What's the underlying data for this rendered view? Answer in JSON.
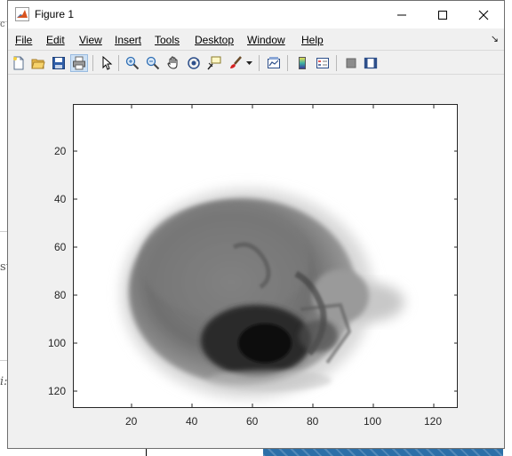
{
  "background": {
    "left_fragments": [
      "c",
      "st",
      "i:"
    ]
  },
  "window": {
    "title": "Figure 1",
    "controls": {
      "minimize": "—",
      "maximize": "☐",
      "close": "✕"
    }
  },
  "menubar": {
    "items": [
      {
        "label": "File",
        "key": "F"
      },
      {
        "label": "Edit",
        "key": "E"
      },
      {
        "label": "View",
        "key": "V"
      },
      {
        "label": "Insert",
        "key": "I"
      },
      {
        "label": "Tools",
        "key": "T"
      },
      {
        "label": "Desktop",
        "key": "D"
      },
      {
        "label": "Window",
        "key": "W"
      },
      {
        "label": "Help",
        "key": "H"
      }
    ],
    "dock_arrow": "↘"
  },
  "toolbar": {
    "icons": [
      "new-figure-icon",
      "open-file-icon",
      "save-icon",
      "print-icon",
      "edit-plot-icon",
      "zoom-in-icon",
      "zoom-out-icon",
      "pan-icon",
      "rotate-3d-icon",
      "data-cursor-icon",
      "brush-icon",
      "link-plot-icon",
      "insert-colorbar-icon",
      "insert-legend-icon",
      "hide-plot-tools-icon",
      "show-plot-tools-icon"
    ]
  },
  "axes": {
    "x_ticks": [
      "20",
      "40",
      "60",
      "80",
      "100",
      "120"
    ],
    "y_ticks": [
      "20",
      "40",
      "60",
      "80",
      "100",
      "120"
    ]
  }
}
